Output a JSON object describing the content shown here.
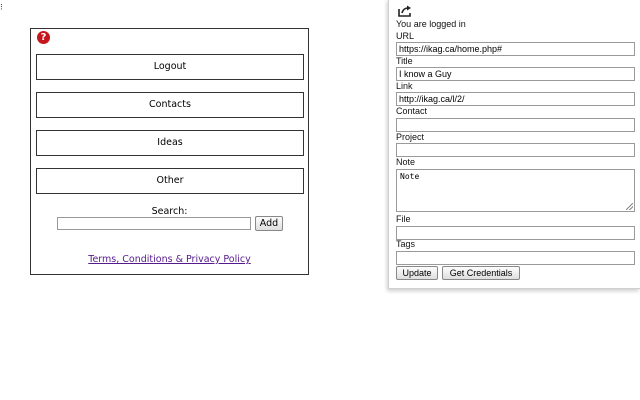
{
  "edge_glyph": "⁝",
  "left_panel": {
    "menu": [
      "Logout",
      "Contacts",
      "Ideas",
      "Other"
    ],
    "search": {
      "label": "Search:",
      "value": "",
      "add_label": "Add"
    },
    "terms_link": "Terms, Conditions & Privacy Policy",
    "help_icon_glyph": "?",
    "colors": {
      "help_icon": "#c4161c",
      "link_visited": "#551a8b"
    }
  },
  "popup": {
    "status": "You are logged in",
    "fields": {
      "url": {
        "label": "URL",
        "value": "https://ikag.ca/home.php#"
      },
      "title": {
        "label": "Title",
        "value": "I know a Guy"
      },
      "link": {
        "label": "Link",
        "value": "http://ikag.ca/l/2/"
      },
      "contact": {
        "label": "Contact",
        "value": ""
      },
      "project": {
        "label": "Project",
        "value": ""
      },
      "note": {
        "label": "Note",
        "value": "Note"
      },
      "file": {
        "label": "File",
        "value": ""
      },
      "tags": {
        "label": "Tags",
        "value": ""
      }
    },
    "buttons": {
      "update": "Update",
      "get_credentials": "Get Credentials"
    }
  },
  "icons": [
    "help-icon",
    "share-icon",
    "resize-grip-icon"
  ]
}
